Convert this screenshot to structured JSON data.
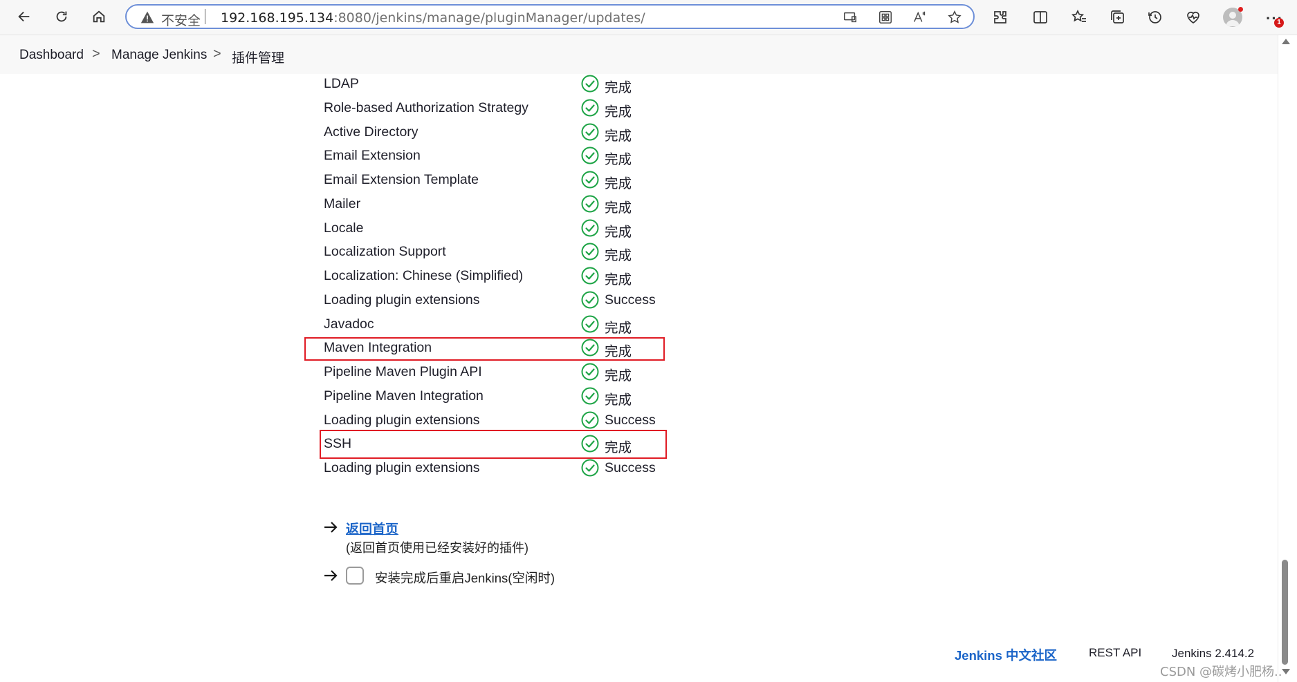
{
  "browser": {
    "security_label": "不安全",
    "url_host": "192.168.195.134",
    "url_rest": ":8080/jenkins/manage/pluginManager/updates/",
    "profile_badge": "1"
  },
  "breadcrumb": {
    "items": [
      "Dashboard",
      "Manage Jenkins",
      "插件管理"
    ],
    "separator": ">"
  },
  "plugins": [
    {
      "name": "LDAP",
      "status": "完成",
      "highlighted": false
    },
    {
      "name": "Role-based Authorization Strategy",
      "status": "完成",
      "highlighted": false
    },
    {
      "name": "Active Directory",
      "status": "完成",
      "highlighted": false
    },
    {
      "name": "Email Extension",
      "status": "完成",
      "highlighted": false
    },
    {
      "name": "Email Extension Template",
      "status": "完成",
      "highlighted": false
    },
    {
      "name": "Mailer",
      "status": "完成",
      "highlighted": false
    },
    {
      "name": "Locale",
      "status": "完成",
      "highlighted": false
    },
    {
      "name": "Localization Support",
      "status": "完成",
      "highlighted": false
    },
    {
      "name": "Localization: Chinese (Simplified)",
      "status": "完成",
      "highlighted": false
    },
    {
      "name": "Loading plugin extensions",
      "status": "Success",
      "highlighted": false
    },
    {
      "name": "Javadoc",
      "status": "完成",
      "highlighted": false
    },
    {
      "name": "Maven Integration",
      "status": "完成",
      "highlighted": true
    },
    {
      "name": "Pipeline Maven Plugin API",
      "status": "完成",
      "highlighted": false
    },
    {
      "name": "Pipeline Maven Integration",
      "status": "完成",
      "highlighted": false
    },
    {
      "name": "Loading plugin extensions",
      "status": "Success",
      "highlighted": false
    },
    {
      "name": "SSH",
      "status": "完成",
      "highlighted": true
    },
    {
      "name": "Loading plugin extensions",
      "status": "Success",
      "highlighted": false
    }
  ],
  "actions": {
    "back_link": "返回首页",
    "back_desc": "(返回首页使用已经安装好的插件)",
    "restart_label": "安装完成后重启Jenkins(空闲时)",
    "restart_checked": false
  },
  "footer": {
    "community": "Jenkins 中文社区",
    "rest_api": "REST API",
    "version": "Jenkins 2.414.2"
  },
  "watermark": "CSDN @碳烤小肥杨..",
  "colors": {
    "success_green": "#1ea446",
    "link_blue": "#1a64c8",
    "highlight_red": "#e01b24"
  }
}
